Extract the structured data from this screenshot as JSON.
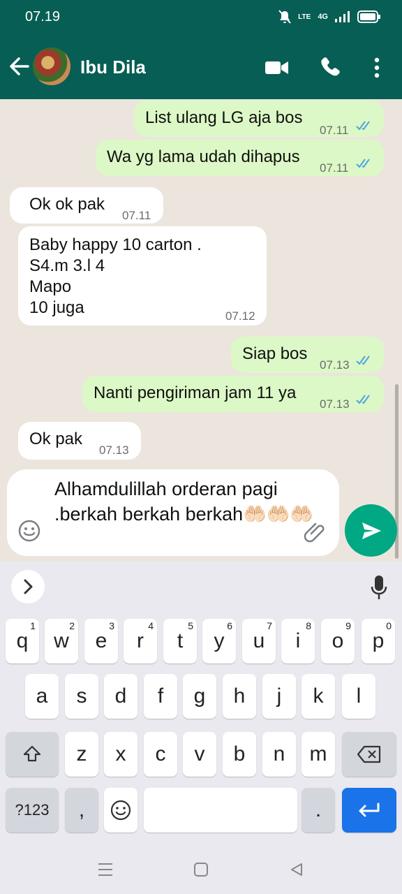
{
  "status": {
    "time": "07.19",
    "network": "4G",
    "volte": "LTE"
  },
  "header": {
    "contact_name": "Ibu Dila"
  },
  "messages": [
    {
      "dir": "out",
      "text": "List ulang LG aja bos",
      "time": "07.11",
      "status": "read"
    },
    {
      "dir": "out",
      "text": "Wa yg lama udah dihapus",
      "time": "07.11",
      "status": "read"
    },
    {
      "dir": "in",
      "text": "Ok ok pak",
      "time": "07.11"
    },
    {
      "dir": "in",
      "text": "Baby happy 10 carton .\nS4.m 3.l 4\nMapo\n10 juga",
      "time": "07.12"
    },
    {
      "dir": "out",
      "text": "Siap bos",
      "time": "07.13",
      "status": "read"
    },
    {
      "dir": "out",
      "text": "Nanti pengiriman jam 11 ya",
      "time": "07.13",
      "status": "read"
    },
    {
      "dir": "in",
      "text": "Ok pak",
      "time": "07.13"
    }
  ],
  "composer": {
    "value": "Alhamdulillah orderan pagi .berkah berkah berkah🤲🏻🤲🏻🤲🏻"
  },
  "keyboard": {
    "row1": [
      {
        "k": "q",
        "n": "1"
      },
      {
        "k": "w",
        "n": "2"
      },
      {
        "k": "e",
        "n": "3"
      },
      {
        "k": "r",
        "n": "4"
      },
      {
        "k": "t",
        "n": "5"
      },
      {
        "k": "y",
        "n": "6"
      },
      {
        "k": "u",
        "n": "7"
      },
      {
        "k": "i",
        "n": "8"
      },
      {
        "k": "o",
        "n": "9"
      },
      {
        "k": "p",
        "n": "0"
      }
    ],
    "row2": [
      "a",
      "s",
      "d",
      "f",
      "g",
      "h",
      "j",
      "k",
      "l"
    ],
    "row3": [
      "z",
      "x",
      "c",
      "v",
      "b",
      "n",
      "m"
    ],
    "symbols_label": "?123",
    "comma": ",",
    "period": "."
  },
  "colors": {
    "header": "#075e54",
    "outgoing_bubble": "#dcf8c6",
    "incoming_bubble": "#ffffff",
    "send_button": "#00a884",
    "read_ticks": "#4fa3e0",
    "enter_key": "#1a73e8"
  }
}
